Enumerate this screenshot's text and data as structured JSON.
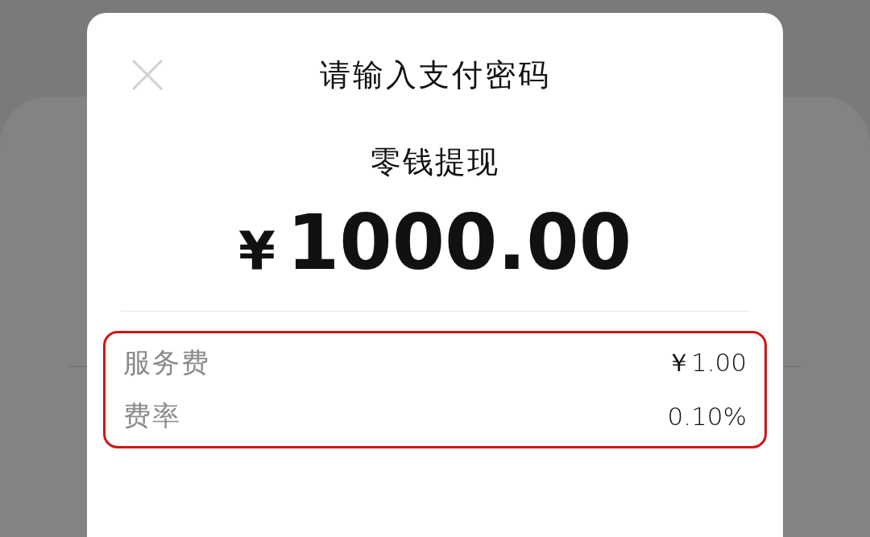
{
  "dialog": {
    "title": "请输入支付密码",
    "subtitle": "零钱提现",
    "currency_symbol": "¥",
    "amount": "1000.00",
    "fees": [
      {
        "label": "服务费",
        "value": "￥1.00"
      },
      {
        "label": "费率",
        "value": "0.10%"
      }
    ]
  }
}
